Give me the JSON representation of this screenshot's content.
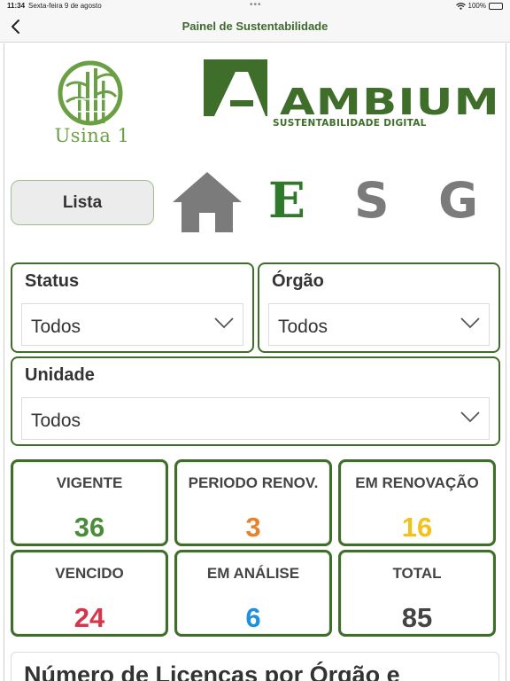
{
  "status_bar": {
    "time": "11:34",
    "date": "Sexta-feira 9 de agosto",
    "battery": "100%"
  },
  "nav": {
    "title": "Painel de Sustentabilidade"
  },
  "logos": {
    "usina": "Usina 1",
    "ambium_word": "AMBIUM",
    "ambium_sub": "SUSTENTABILIDADE DIGITAL"
  },
  "tabs": {
    "lista": "Lista",
    "e": "E",
    "s": "S",
    "g": "G"
  },
  "filters": {
    "status": {
      "label": "Status",
      "value": "Todos"
    },
    "orgao": {
      "label": "Órgão",
      "value": "Todos"
    },
    "unidade": {
      "label": "Unidade",
      "value": "Todos"
    }
  },
  "stats": [
    {
      "label": "VIGENTE",
      "value": "36",
      "color": "#4a8c3a"
    },
    {
      "label": "PERIODO RENOV.",
      "value": "3",
      "color": "#e8822a"
    },
    {
      "label": "EM RENOVAÇÃO",
      "value": "16",
      "color": "#f2c21b"
    },
    {
      "label": "VENCIDO",
      "value": "24",
      "color": "#d8344a"
    },
    {
      "label": "EM ANÁLISE",
      "value": "6",
      "color": "#1f8fe0"
    },
    {
      "label": "TOTAL",
      "value": "85",
      "color": "#444444"
    }
  ],
  "section": {
    "title": "Número de Licenças por Órgão e"
  },
  "colors": {
    "brand_green": "#3f6d2a",
    "usina_green": "#6aa043",
    "icon_gray": "#7b7b7b"
  }
}
